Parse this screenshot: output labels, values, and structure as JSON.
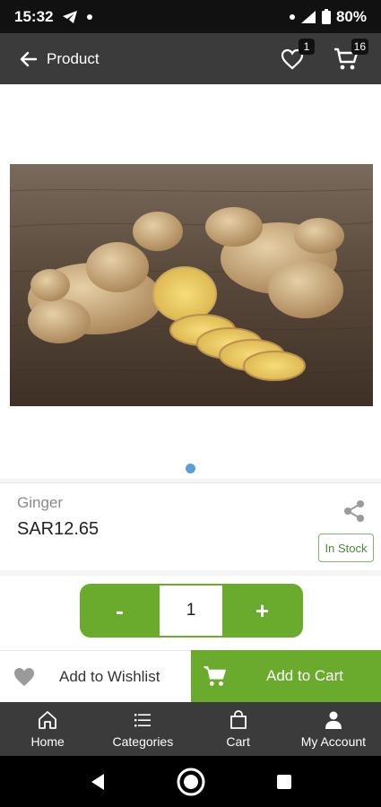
{
  "status_bar": {
    "time": "15:32",
    "battery": "80%",
    "icons": [
      "telegram-icon",
      "dot-icon",
      "dot-icon",
      "wifi-icon",
      "signal-icon",
      "battery-icon"
    ]
  },
  "app_bar": {
    "title": "Product",
    "wishlist_count": "1",
    "cart_count": "16",
    "icons": [
      "back-arrow-icon",
      "heart-outline-icon",
      "cart-icon"
    ]
  },
  "product": {
    "name": "Ginger",
    "price": "SAR12.65",
    "stock": "In Stock",
    "image_subject": "ginger roots with slices on wooden table"
  },
  "quantity": {
    "minus": "-",
    "value": "1",
    "plus": "+"
  },
  "actions": {
    "wishlist_label": "Add to Wishlist",
    "cart_label": "Add to Cart"
  },
  "bottom_nav": {
    "items": [
      {
        "label": "Home",
        "icon": "home-icon"
      },
      {
        "label": "Categories",
        "icon": "list-icon"
      },
      {
        "label": "Cart",
        "icon": "bag-icon"
      },
      {
        "label": "My Account",
        "icon": "person-icon"
      }
    ]
  },
  "colors": {
    "accent_green": "#6aaa2c",
    "app_bar": "#3b3b3b",
    "dot_blue": "#5aa0d6"
  }
}
